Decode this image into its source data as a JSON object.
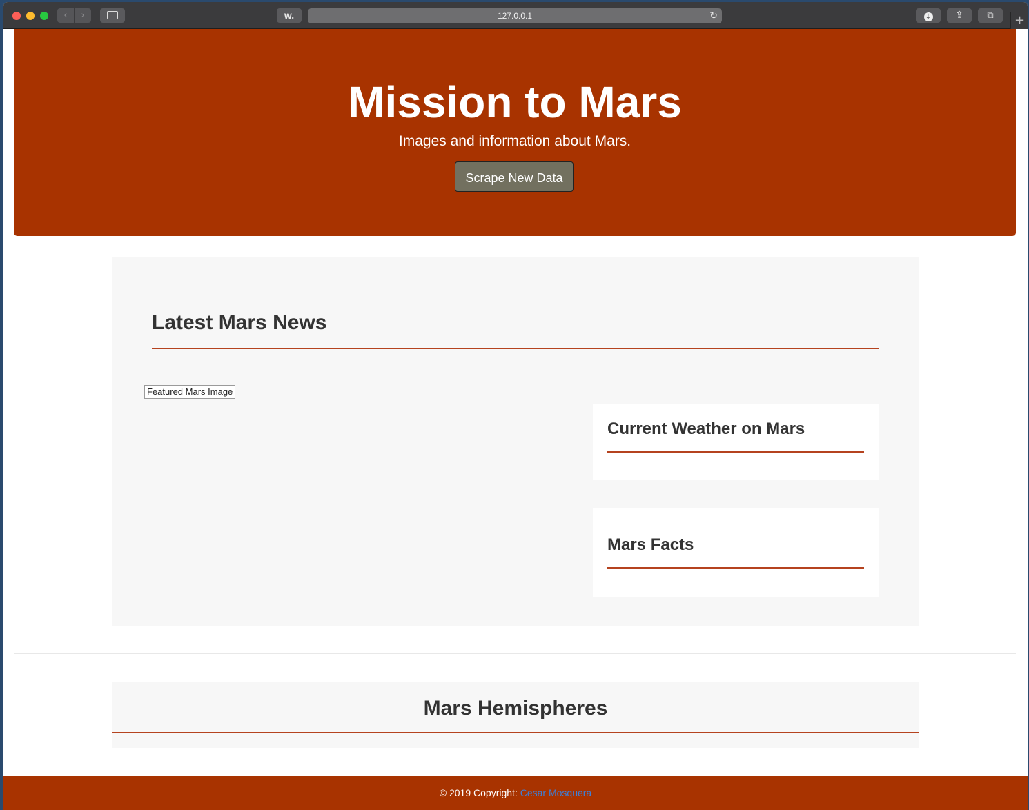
{
  "browser": {
    "url": "127.0.0.1",
    "reader_button": "w.",
    "back_glyph": "‹",
    "forward_glyph": "›",
    "reload_glyph": "↻",
    "download_glyph": "↓",
    "share_glyph": "⇪",
    "tabs_glyph": "⧉",
    "new_tab_glyph": "+"
  },
  "jumbotron": {
    "title": "Mission to Mars",
    "lead": "Images and information about Mars.",
    "scrape_button": "Scrape New Data"
  },
  "news": {
    "title": "Latest Mars News",
    "featured_image_alt": "Featured Mars Image"
  },
  "weather": {
    "title": "Current Weather on Mars"
  },
  "facts": {
    "title": "Mars Facts"
  },
  "hemispheres": {
    "title": "Mars Hemispheres"
  },
  "footer": {
    "copyright": "© 2019 Copyright:",
    "author": "Cesar Mosquera"
  },
  "colors": {
    "brand": "#a83300",
    "accent_rule": "#b5431f",
    "button": "#72705f",
    "link": "#3e7fd6",
    "well": "#f7f7f7"
  },
  "icons": [
    "back-icon",
    "forward-icon",
    "sidebar-icon",
    "reload-icon",
    "download-icon",
    "share-icon",
    "tabs-icon",
    "new-tab-icon"
  ]
}
